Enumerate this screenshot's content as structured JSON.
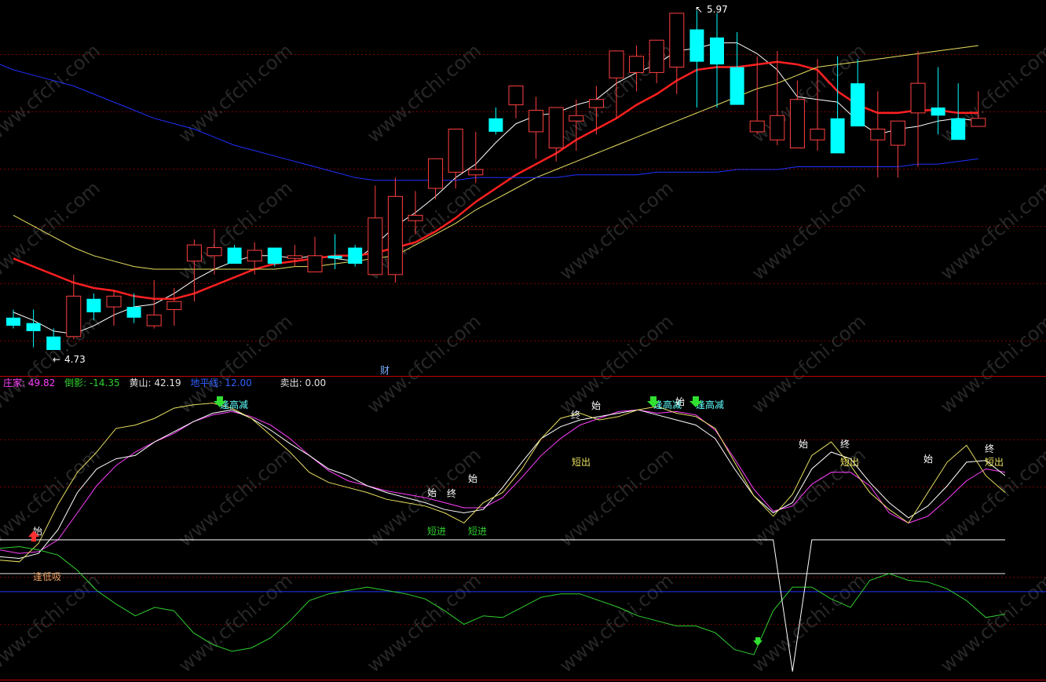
{
  "watermark": "www.cfchi.com",
  "colors": {
    "bg": "#000000",
    "grid": "#7a0000",
    "up": "#ff4040",
    "down": "#00ffff",
    "ma_white": "#ffffff",
    "ma_red": "#ff2020",
    "ma_yellow": "#e8e060",
    "ma_blue": "#2030ff",
    "k_line": "#ff40ff",
    "d_line": "#e8e060",
    "j_line": "#ffffff",
    "green_line": "#30d030",
    "divider": "#c00000"
  },
  "price_panel": {
    "high_label": "5.97",
    "low_label": "4.73",
    "fin_marker": "财",
    "ylim": [
      4.66,
      6.0
    ]
  },
  "indicator_header": [
    {
      "label": "庄家",
      "value": "49.82",
      "label_color": "#ff40ff",
      "value_color": "#ff40ff"
    },
    {
      "label": "倒影",
      "value": "-14.35",
      "label_color": "#30d030",
      "value_color": "#30d030"
    },
    {
      "label": "黄山",
      "value": "42.19",
      "label_color": "#e0e0e0",
      "value_color": "#e0e0e0"
    },
    {
      "label": "地平线",
      "value": "12.00",
      "label_color": "#3060ff",
      "value_color": "#3060ff"
    },
    {
      "label": "卖出",
      "value": "0.00",
      "label_color": "#e0e0e0",
      "value_color": "#e0e0e0"
    }
  ],
  "signals": {
    "shi": "始",
    "zhong": "终",
    "feng_gao_jian": "逢高减",
    "duan_chu": "短出",
    "duan_jin": "短进",
    "feng_di_xi": "逢低吸"
  },
  "chart_data": {
    "type": "candlestick",
    "x": [
      1,
      2,
      3,
      4,
      5,
      6,
      7,
      8,
      9,
      10,
      11,
      12,
      13,
      14,
      15,
      16,
      17,
      18,
      19,
      20,
      21,
      22,
      23,
      24,
      25,
      26,
      27,
      28,
      29,
      30,
      31,
      32,
      33,
      34,
      35,
      36,
      37,
      38,
      39,
      40,
      41,
      42,
      43,
      44,
      45,
      46,
      47,
      48,
      49
    ],
    "candles": {
      "open": [
        4.85,
        4.83,
        4.78,
        4.78,
        4.92,
        4.89,
        4.89,
        4.82,
        4.88,
        5.06,
        5.08,
        5.11,
        5.06,
        5.11,
        5.07,
        5.02,
        5.08,
        5.11,
        5.01,
        5.01,
        5.21,
        5.33,
        5.39,
        5.38,
        5.59,
        5.64,
        5.54,
        5.48,
        5.58,
        5.63,
        5.74,
        5.76,
        5.76,
        5.78,
        5.92,
        5.89,
        5.78,
        5.54,
        5.51,
        5.48,
        5.51,
        5.59,
        5.72,
        5.51,
        5.49,
        5.61,
        5.63,
        5.59,
        5.56
      ],
      "high": [
        4.88,
        4.88,
        4.81,
        5.01,
        4.94,
        4.95,
        4.94,
        4.99,
        4.96,
        5.14,
        5.18,
        5.12,
        5.13,
        5.11,
        5.12,
        5.15,
        5.16,
        5.12,
        5.34,
        5.37,
        5.32,
        5.44,
        5.44,
        5.54,
        5.63,
        5.68,
        5.67,
        5.58,
        5.66,
        5.71,
        5.83,
        5.86,
        5.84,
        5.97,
        5.99,
        5.98,
        5.91,
        5.82,
        5.84,
        5.73,
        5.81,
        5.82,
        5.81,
        5.69,
        5.58,
        5.84,
        5.78,
        5.72,
        5.69
      ],
      "low": [
        4.81,
        4.74,
        4.73,
        4.77,
        4.84,
        4.82,
        4.83,
        4.81,
        4.82,
        4.91,
        5.01,
        5.06,
        5.01,
        5.04,
        5.04,
        5.03,
        5.03,
        5.04,
        5.02,
        4.98,
        5.16,
        5.29,
        5.33,
        5.35,
        5.53,
        5.59,
        5.44,
        5.43,
        5.47,
        5.53,
        5.59,
        5.69,
        5.72,
        5.68,
        5.63,
        5.63,
        5.71,
        5.53,
        5.49,
        5.48,
        5.47,
        5.59,
        5.59,
        5.37,
        5.37,
        5.41,
        5.53,
        5.56,
        5.56
      ],
      "close": [
        4.82,
        4.8,
        4.73,
        4.93,
        4.87,
        4.93,
        4.85,
        4.86,
        4.91,
        5.12,
        5.11,
        5.05,
        5.1,
        5.05,
        5.08,
        5.08,
        5.07,
        5.05,
        5.22,
        5.3,
        5.23,
        5.44,
        5.55,
        5.4,
        5.54,
        5.71,
        5.62,
        5.63,
        5.6,
        5.66,
        5.84,
        5.82,
        5.88,
        5.98,
        5.8,
        5.79,
        5.64,
        5.58,
        5.6,
        5.66,
        5.55,
        5.46,
        5.56,
        5.55,
        5.58,
        5.72,
        5.6,
        5.51,
        5.59
      ],
      "up_color": "#ff4040",
      "down_color": "#00ffff"
    },
    "moving_averages": [
      {
        "color": "#ffffff",
        "width": 1,
        "values": [
          4.87,
          4.84,
          4.8,
          4.79,
          4.82,
          4.86,
          4.89,
          4.9,
          4.94,
          4.99,
          5.03,
          5.06,
          5.08,
          5.08,
          5.07,
          5.08,
          5.07,
          5.06,
          5.12,
          5.19,
          5.24,
          5.3,
          5.37,
          5.42,
          5.5,
          5.57,
          5.6,
          5.61,
          5.64,
          5.66,
          5.72,
          5.76,
          5.79,
          5.84,
          5.85,
          5.87,
          5.87,
          5.83,
          5.77,
          5.67,
          5.66,
          5.65,
          5.58,
          5.53,
          5.55,
          5.56,
          5.58,
          5.59,
          5.58
        ]
      },
      {
        "color": "#ff2020",
        "width": 2.5,
        "values": [
          5.07,
          5.04,
          5.01,
          4.98,
          4.96,
          4.95,
          4.93,
          4.92,
          4.92,
          4.94,
          4.97,
          5.0,
          5.03,
          5.05,
          5.06,
          5.07,
          5.08,
          5.08,
          5.09,
          5.11,
          5.13,
          5.17,
          5.22,
          5.28,
          5.33,
          5.38,
          5.42,
          5.46,
          5.51,
          5.55,
          5.59,
          5.64,
          5.68,
          5.73,
          5.77,
          5.78,
          5.78,
          5.79,
          5.8,
          5.79,
          5.77,
          5.69,
          5.64,
          5.61,
          5.61,
          5.62,
          5.62,
          5.61,
          5.61
        ]
      },
      {
        "color": "#e8e060",
        "width": 1,
        "values": [
          5.23,
          5.19,
          5.15,
          5.11,
          5.08,
          5.06,
          5.04,
          5.03,
          5.03,
          5.03,
          5.03,
          5.03,
          5.03,
          5.03,
          5.04,
          5.04,
          5.05,
          5.06,
          5.07,
          5.08,
          5.12,
          5.16,
          5.2,
          5.25,
          5.29,
          5.33,
          5.37,
          5.4,
          5.43,
          5.46,
          5.49,
          5.52,
          5.55,
          5.58,
          5.61,
          5.64,
          5.67,
          5.7,
          5.72,
          5.75,
          5.78,
          5.79,
          5.8,
          5.81,
          5.82,
          5.83,
          5.84,
          5.85,
          5.86
        ]
      },
      {
        "color": "#2030ff",
        "width": 1,
        "values": [
          5.77,
          5.75,
          5.73,
          5.71,
          5.68,
          5.65,
          5.62,
          5.59,
          5.57,
          5.55,
          5.52,
          5.49,
          5.47,
          5.45,
          5.43,
          5.41,
          5.39,
          5.37,
          5.36,
          5.36,
          5.36,
          5.36,
          5.36,
          5.37,
          5.37,
          5.37,
          5.37,
          5.37,
          5.38,
          5.38,
          5.38,
          5.38,
          5.39,
          5.39,
          5.39,
          5.39,
          5.4,
          5.4,
          5.4,
          5.41,
          5.41,
          5.41,
          5.41,
          5.41,
          5.41,
          5.42,
          5.42,
          5.43,
          5.44
        ]
      }
    ],
    "indicator": {
      "ylim": [
        -60,
        105
      ],
      "zero_line": 0,
      "horizon_line": 12,
      "white_level": 20,
      "series": [
        {
          "name": "庄家",
          "color": "#ff40ff",
          "values": [
            14,
            12,
            13,
            20,
            36,
            52,
            64,
            72,
            78,
            83,
            90,
            94,
            96,
            93,
            88,
            80,
            70,
            61,
            55,
            52,
            49,
            47,
            45,
            42,
            39,
            39,
            45,
            57,
            70,
            80,
            88,
            92,
            96,
            97,
            95,
            96,
            94,
            85,
            68,
            50,
            37,
            40,
            53,
            60,
            60,
            52,
            36,
            30,
            34,
            44,
            55,
            62,
            60
          ]
        },
        {
          "name": "黄山",
          "color": "#ffffff",
          "values": [
            10,
            9,
            12,
            26,
            48,
            62,
            68,
            70,
            78,
            84,
            90,
            95,
            97,
            92,
            85,
            77,
            70,
            62,
            58,
            52,
            48,
            45,
            42,
            38,
            36,
            38,
            51,
            66,
            80,
            87,
            91,
            93,
            95,
            97,
            94,
            91,
            88,
            80,
            62,
            46,
            36,
            42,
            62,
            72,
            68,
            54,
            42,
            33,
            40,
            52,
            66,
            67,
            58
          ]
        },
        {
          "name": "D",
          "color": "#e8e060",
          "values": [
            8,
            7,
            18,
            41,
            60,
            72,
            86,
            88,
            92,
            98,
            100,
            101,
            98,
            92,
            82,
            72,
            60,
            54,
            51,
            48,
            44,
            42,
            40,
            36,
            30,
            42,
            48,
            62,
            80,
            92,
            95,
            91,
            93,
            97,
            99,
            95,
            93,
            86,
            66,
            46,
            34,
            47,
            70,
            78,
            64,
            48,
            38,
            30,
            48,
            66,
            76,
            58,
            48
          ]
        },
        {
          "name": "倒影",
          "color": "#30d030",
          "values": [
            15,
            16,
            14,
            11,
            2,
            -10,
            -18,
            -25,
            -20,
            -22,
            -35,
            -42,
            -46,
            -44,
            -38,
            -28,
            -16,
            -12,
            -10,
            -8,
            -10,
            -12,
            -15,
            -22,
            -30,
            -25,
            -26,
            -20,
            -14,
            -12,
            -12,
            -16,
            -20,
            -25,
            -28,
            -31,
            -31,
            -35,
            -45,
            -48,
            -22,
            -8,
            -8,
            -15,
            -20,
            -4,
            0,
            -4,
            -5,
            -9,
            -16,
            -26,
            -24
          ]
        },
        {
          "name": "卖出",
          "color": "#ffffff",
          "values": [
            20,
            20,
            20,
            20,
            20,
            20,
            20,
            20,
            20,
            20,
            20,
            20,
            20,
            20,
            20,
            20,
            20,
            20,
            20,
            20,
            20,
            20,
            20,
            20,
            20,
            20,
            20,
            20,
            20,
            20,
            20,
            20,
            20,
            20,
            20,
            20,
            20,
            20,
            20,
            20,
            20,
            -58,
            20,
            20,
            20,
            20,
            20,
            20,
            20,
            20,
            20,
            20,
            20
          ]
        }
      ]
    }
  }
}
